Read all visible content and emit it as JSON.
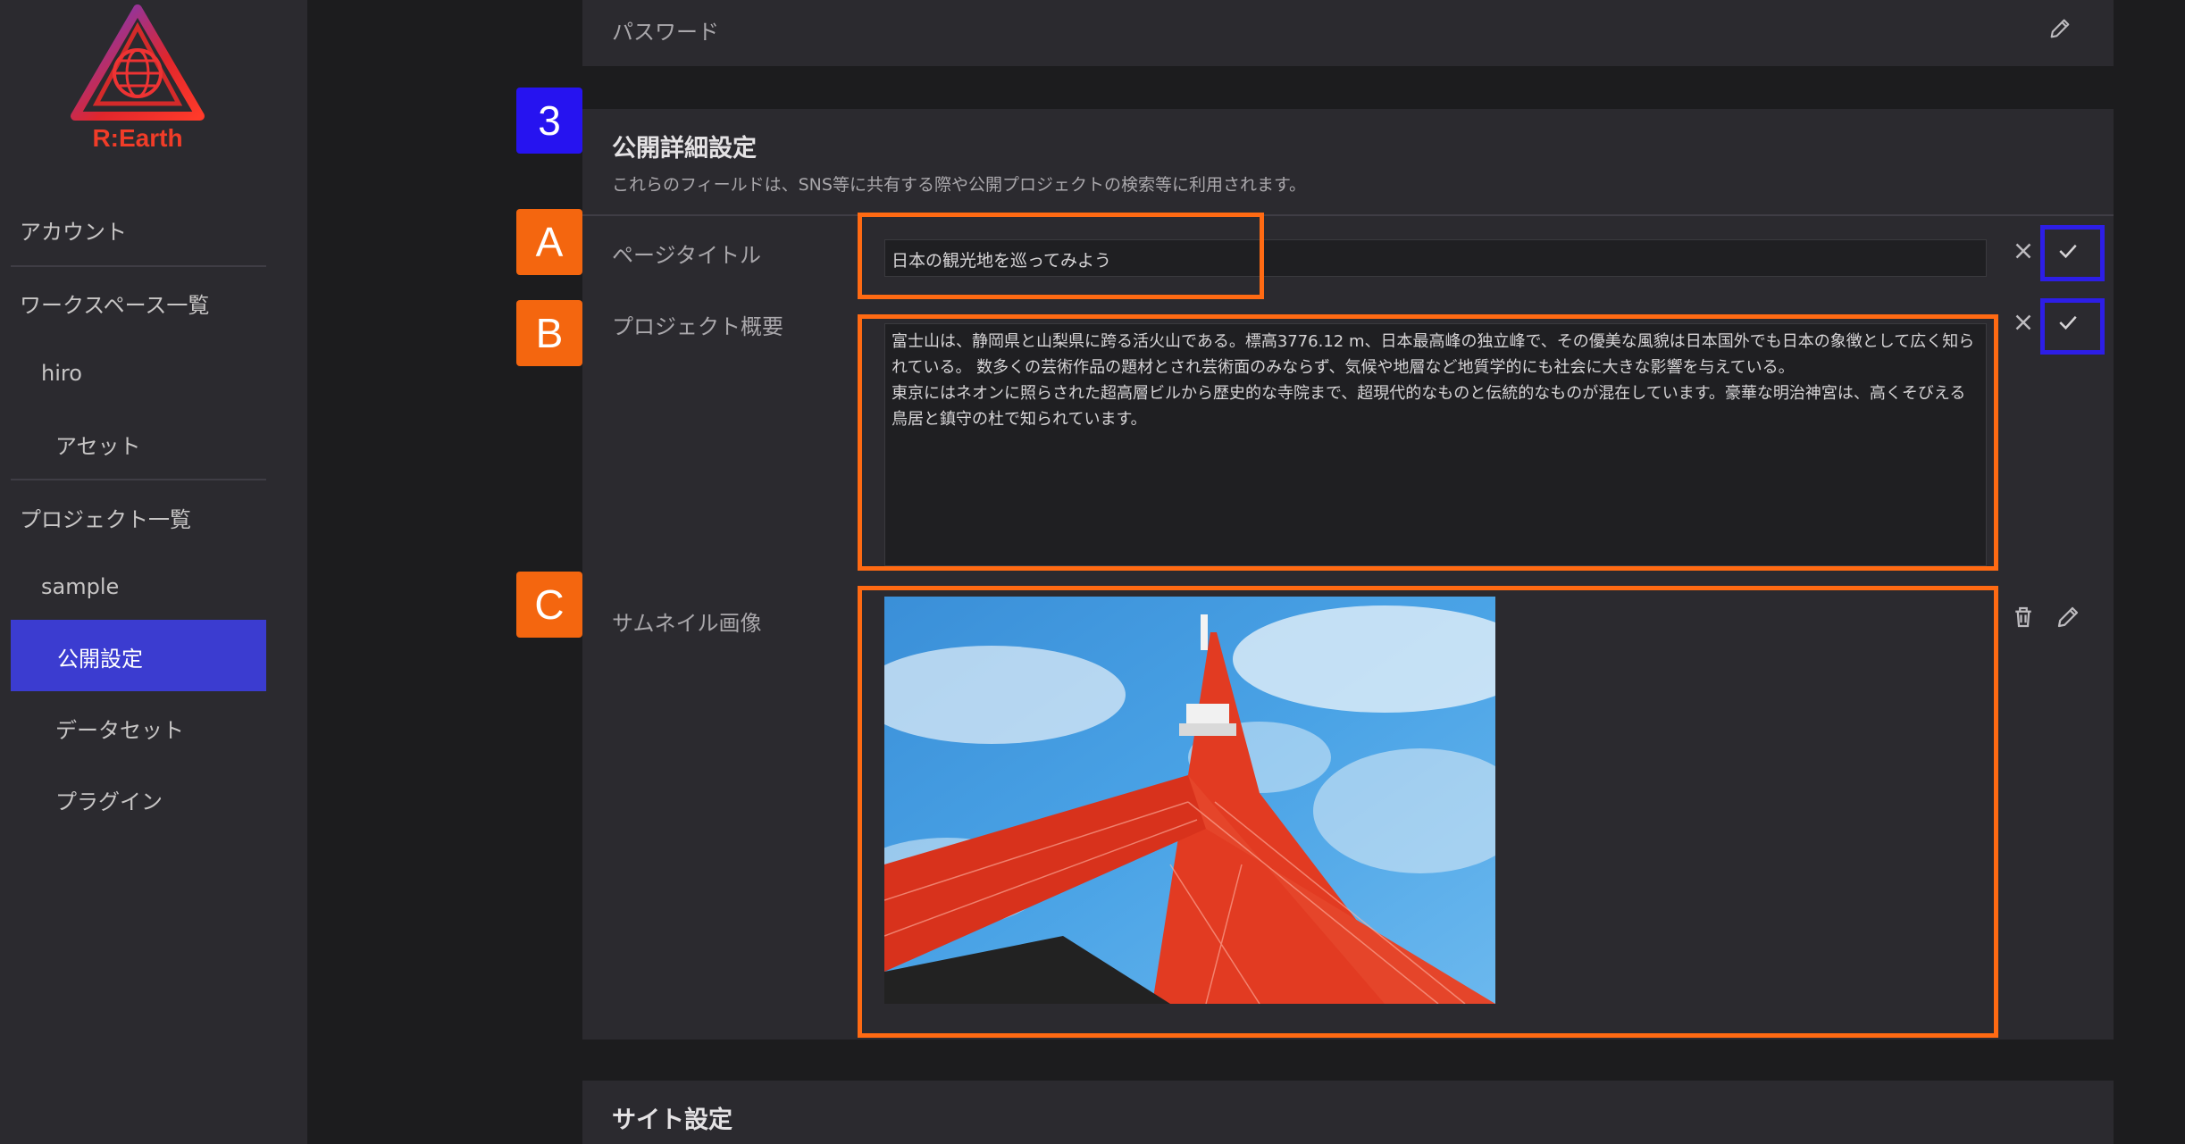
{
  "brand": {
    "name": "R:Earth"
  },
  "sidebar": {
    "items": [
      {
        "label": "アカウント"
      },
      {
        "label": "ワークスペース一覧"
      },
      {
        "label": "hiro"
      },
      {
        "label": "アセット"
      },
      {
        "label": "プロジェクト一覧"
      },
      {
        "label": "sample"
      },
      {
        "label": "公開設定",
        "active": true
      },
      {
        "label": "データセット"
      },
      {
        "label": "プラグイン"
      }
    ]
  },
  "password_section": {
    "label": "パスワード"
  },
  "public_details": {
    "title": "公開詳細設定",
    "description": "これらのフィールドは、SNS等に共有する際や公開プロジェクトの検索等に利用されます。",
    "fields": {
      "page_title": {
        "label": "ページタイトル",
        "value": "日本の観光地を巡ってみよう"
      },
      "project_summary": {
        "label": "プロジェクト概要",
        "value": "富士山は、静岡県と山梨県に跨る活火山である。標高3776.12 m、日本最高峰の独立峰で、その優美な風貌は日本国外でも日本の象徴として広く知られている。 数多くの芸術作品の題材とされ芸術面のみならず、気候や地層など地質学的にも社会に大きな影響を与えている。\n東京にはネオンに照らされた超高層ビルから歴史的な寺院まで、超現代的なものと伝統的なものが混在しています。豪華な明治神宮は、高くそびえる鳥居と鎮守の杜で知られています。"
      },
      "thumbnail": {
        "label": "サムネイル画像"
      }
    }
  },
  "site_settings": {
    "title": "サイト設定"
  },
  "annotations": {
    "step": "3",
    "a": "A",
    "b": "B",
    "c": "C"
  },
  "colors": {
    "accent": "#3b3cd0",
    "highlight_orange": "#ff6a13",
    "highlight_blue": "#2d1ee6",
    "background": "#1c1c1e",
    "panel": "#2b2a2f"
  }
}
